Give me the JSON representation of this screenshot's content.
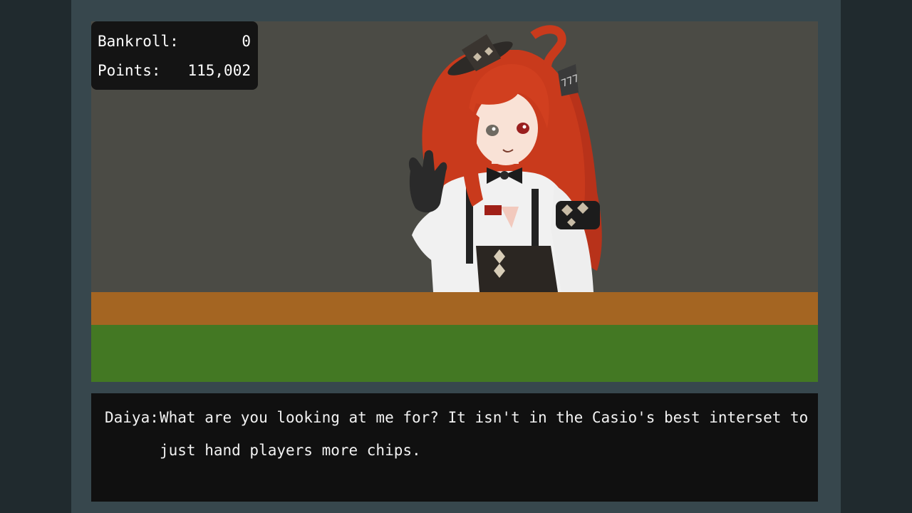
{
  "hud": {
    "bankroll_label": "Bankroll:",
    "bankroll_value": "0",
    "points_label": "Points:",
    "points_value": "115,002"
  },
  "dealer": {
    "name": "Daiya",
    "hair_clip_text": "777"
  },
  "dialogue": {
    "speaker": "Daiya:",
    "line1": "What are you looking at me for? It isn't in the Casio's best interset to",
    "line2": "just hand players more chips."
  },
  "colors": {
    "backdrop": "#4b4b45",
    "table_rail": "#a46522",
    "table_felt": "#437823",
    "dialog_bg": "#101010",
    "frame": "#37474d"
  }
}
